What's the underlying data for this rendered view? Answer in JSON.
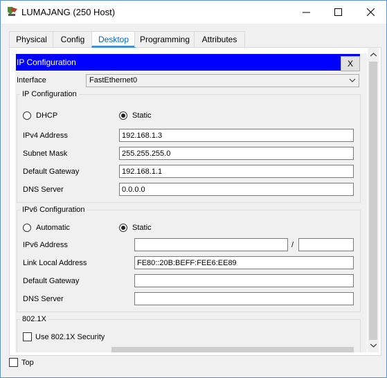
{
  "window": {
    "title": "LUMAJANG (250 Host)",
    "accent": "#0000ff"
  },
  "tabs": [
    {
      "label": "Physical",
      "active": false
    },
    {
      "label": "Config",
      "active": false
    },
    {
      "label": "Desktop",
      "active": true
    },
    {
      "label": "Programming",
      "active": false
    },
    {
      "label": "Attributes",
      "active": false
    }
  ],
  "panel": {
    "title": "IP Configuration",
    "close_label": "X",
    "interface_label": "Interface",
    "interface_value": "FastEthernet0"
  },
  "ipv4": {
    "group_title": "IP Configuration",
    "dhcp_label": "DHCP",
    "static_label": "Static",
    "mode": "Static",
    "address_label": "IPv4 Address",
    "address": "192.168.1.3",
    "mask_label": "Subnet Mask",
    "mask": "255.255.255.0",
    "gateway_label": "Default Gateway",
    "gateway": "192.168.1.1",
    "dns_label": "DNS Server",
    "dns": "0.0.0.0"
  },
  "ipv6": {
    "group_title": "IPv6 Configuration",
    "auto_label": "Automatic",
    "static_label": "Static",
    "mode": "Static",
    "address_label": "IPv6 Address",
    "address": "",
    "slash": "/",
    "prefix": "",
    "link_local_label": "Link Local Address",
    "link_local": "FE80::20B:BEFF:FEE6:EE89",
    "gateway_label": "Default Gateway",
    "gateway": "",
    "dns_label": "DNS Server",
    "dns": ""
  },
  "dot1x": {
    "group_title": "802.1X",
    "use_label": "Use 802.1X Security",
    "checked": false
  },
  "footer": {
    "top_label": "Top",
    "checked": false
  }
}
